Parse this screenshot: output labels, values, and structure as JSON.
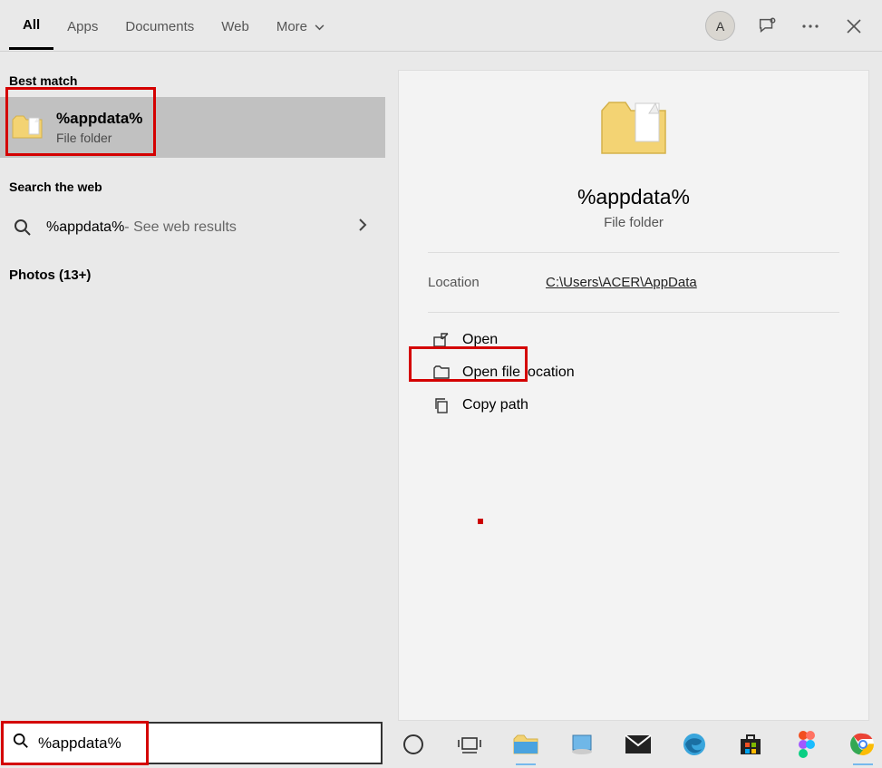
{
  "tabs": {
    "all": "All",
    "apps": "Apps",
    "documents": "Documents",
    "web": "Web",
    "more": "More"
  },
  "avatar": {
    "letter": "A"
  },
  "sections": {
    "best_match": "Best match",
    "search_web": "Search the web",
    "photos": "Photos (13+)"
  },
  "best_match": {
    "title": "%appdata%",
    "subtitle": "File folder"
  },
  "web_result": {
    "query": "%appdata%",
    "suffix": " - See web results"
  },
  "preview": {
    "title": "%appdata%",
    "subtitle": "File folder",
    "location_label": "Location",
    "location_value": "C:\\Users\\ACER\\AppData"
  },
  "actions": {
    "open": "Open",
    "open_location": "Open file location",
    "copy_path": "Copy path"
  },
  "search_input": {
    "value": "%appdata%"
  },
  "icons": {
    "chevron_down": "chevron-down-icon",
    "feedback": "feedback-icon",
    "more": "more-icon",
    "close": "close-icon",
    "search": "search-icon",
    "open": "open-icon",
    "folder": "folder-icon",
    "copy": "copy-icon",
    "cortana": "cortana-icon",
    "taskview": "taskview-icon",
    "explorer": "explorer-icon",
    "notepad": "notepad-icon",
    "mail": "mail-icon",
    "edge": "edge-icon",
    "store": "store-icon",
    "figma": "figma-icon",
    "chrome": "chrome-icon"
  }
}
